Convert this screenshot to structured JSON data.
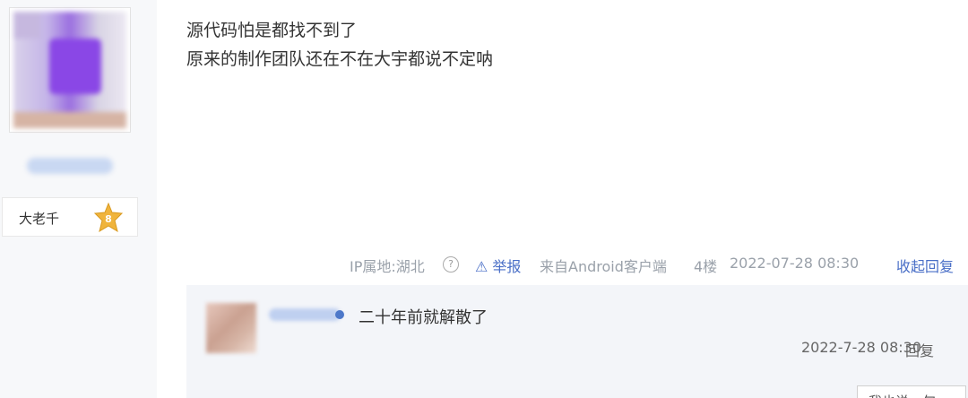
{
  "post": {
    "lines": [
      "源代码怕是都找不到了",
      "原来的制作团队还在不在大宇都说不定呐"
    ],
    "author": {
      "rank": "大老千",
      "level": "8"
    },
    "meta": {
      "ip": "IP属地:湖北",
      "help": "?",
      "report": "⚠ 举报",
      "source": "来自Android客户端",
      "floor": "4楼",
      "time": "2022-07-28 08:30",
      "reply": "收起回复"
    }
  },
  "reply": {
    "text": "二十年前就解散了",
    "time": "2022-7-28 08:30",
    "reply_label": "回复",
    "say_placeholder": "我也说一句"
  },
  "colors": {
    "link": "#4a6fc7",
    "badge": "#f0b43c"
  }
}
